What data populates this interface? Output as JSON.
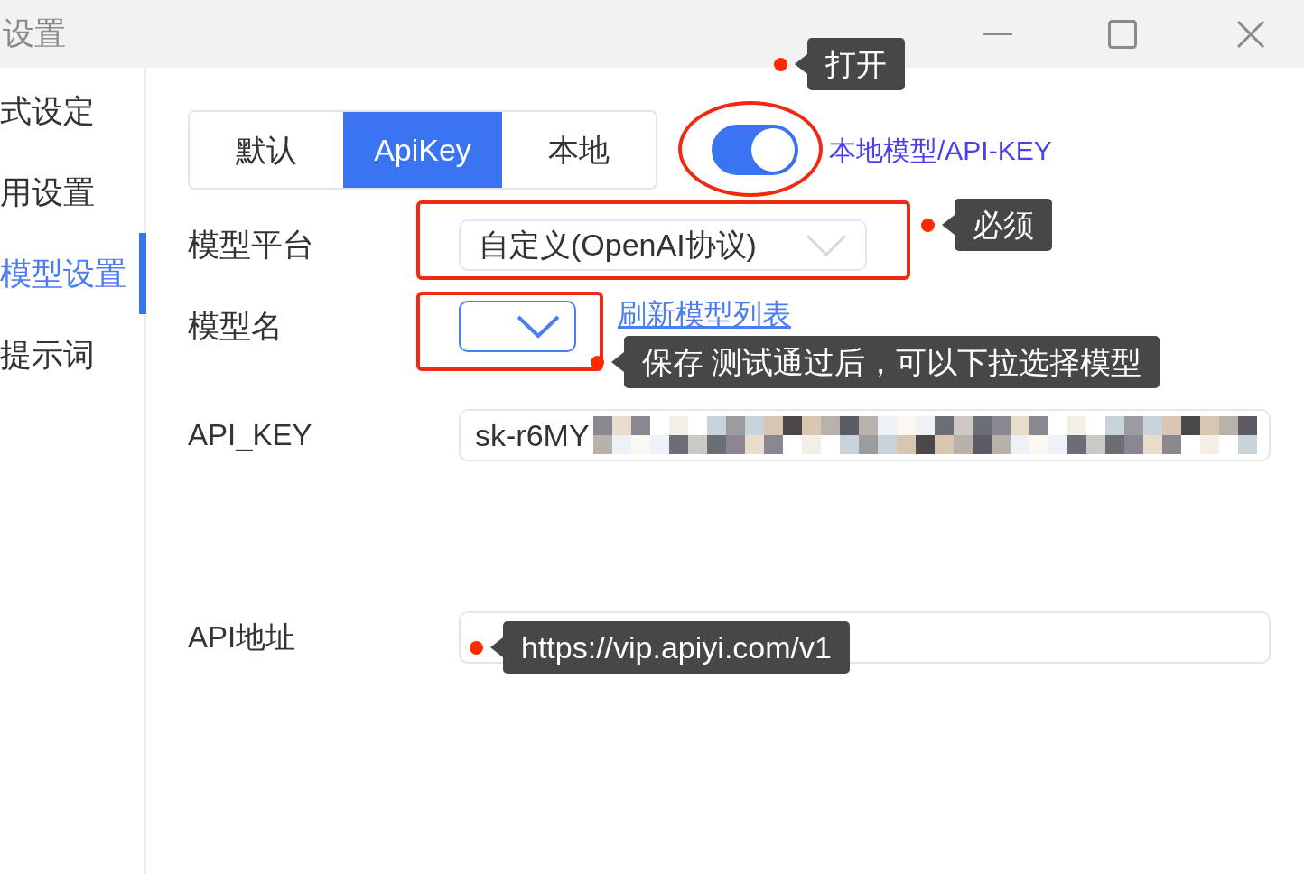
{
  "window": {
    "title": "设置"
  },
  "sidebar": {
    "items": [
      {
        "label": "式设定",
        "selected": false
      },
      {
        "label": "用设置",
        "selected": false
      },
      {
        "label": "模型设置",
        "selected": true
      },
      {
        "label": "提示词",
        "selected": false
      }
    ]
  },
  "mode_tabs": [
    {
      "label": "默认",
      "selected": false
    },
    {
      "label": "ApiKey",
      "selected": true
    },
    {
      "label": "本地",
      "selected": false
    }
  ],
  "toggle": {
    "on": true,
    "label": "本地模型/API-KEY"
  },
  "form": {
    "model_platform": {
      "label": "模型平台",
      "value": "自定义(OpenAI协议)"
    },
    "model_name": {
      "label": "模型名",
      "focused": true,
      "link": "刷新模型列表"
    },
    "api_key": {
      "label": "API_KEY",
      "value": "sk-r6MY",
      "masked": true
    },
    "api_address": {
      "label": "API地址"
    }
  },
  "callouts": [
    {
      "text": "打开"
    },
    {
      "text": "必须"
    },
    {
      "text": "保存 测试通过后，可以下拉选择模型"
    },
    {
      "text": "https://vip.apiyi.com/v1"
    }
  ]
}
